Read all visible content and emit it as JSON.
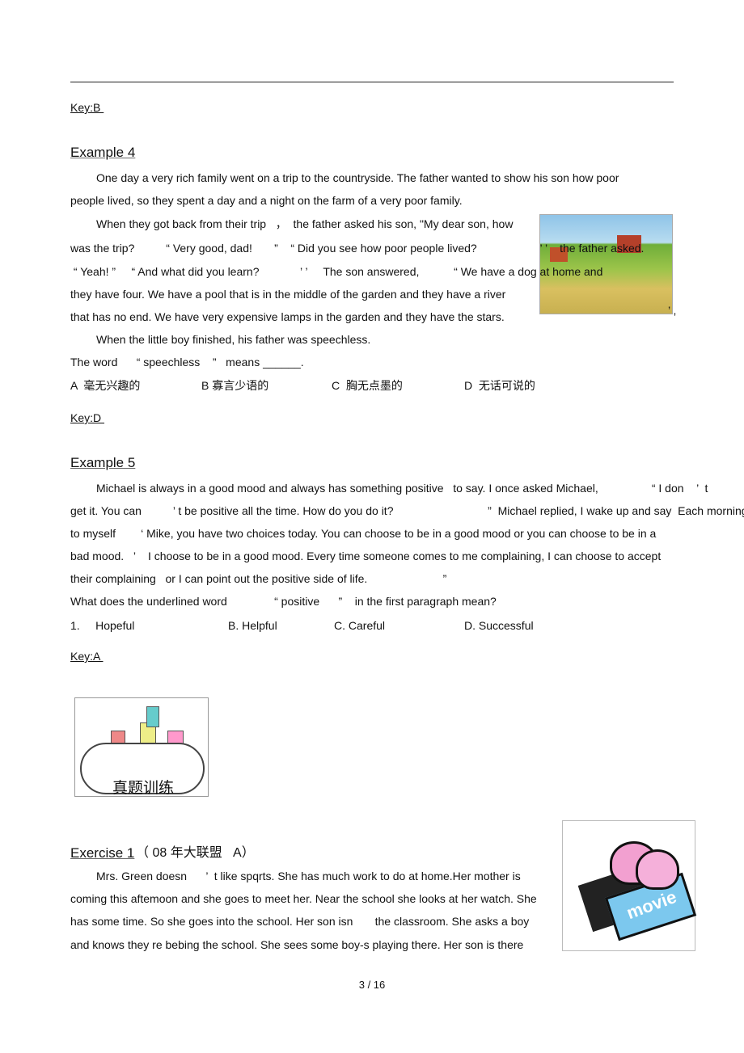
{
  "keys": {
    "k3": "Key:B ",
    "k4": "Key:D ",
    "k5": "Key:A "
  },
  "ex4": {
    "title": "Example 4",
    "lines": [
      "One day a very rich family went on a trip to the countryside. The father wanted to show his son how poor",
      "people lived, so they spent a day and a night on the farm of a very poor family.",
      "When they got back from their trip   ，  the father asked his son, \"My dear son, how",
      "was the trip?          “ Very good, dad!       ”    “ Did you see how poor people lived?                    ’ ’    the father asked.",
      " “ Yeah! ”     “ And what did you learn?             ’ ’     The son answered,           “ We have a dog at home and",
      "they have four. We have a pool that is in the middle of the garden and they have a river",
      "that has no end. We have very expensive lamps in the garden and they have the stars.",
      "When the little boy finished, his father was speechless.",
      "The word      “ speechless    ”   means ______."
    ],
    "trailing_quote": "’ ,",
    "options": [
      "A  毫无兴趣的",
      "B 寡言少语的",
      "C  胸无点墨的",
      "D  无话可说的"
    ]
  },
  "ex5": {
    "title": "Example 5",
    "lines": [
      "Michael is always in a good mood and always has something positive   to say. I once asked Michael,                 “ I don    ’  t",
      "get it. You can          ’ t be positive all the time. How do you do it?                              ”  Michael replied, I wake up and say  Each morning",
      "to myself        ‘ Mike, you have two choices today. You can choose to be in a good mood or you can choose to be in a",
      "bad mood.   ’    I choose to be in a good mood. Every time someone comes to me complaining, I can choose to accept",
      "their complaining   or I can point out the positive side of life.                        ”",
      "What does the underlined word               “ positive      ”    in the first paragraph mean?"
    ],
    "options": [
      "1.     Hopeful",
      "B. Helpful",
      "C. Careful",
      "D. Successful"
    ]
  },
  "banner": "真题训练",
  "exercise1": {
    "title": "Exercise 1",
    "subtitle": "（ 08 年大联盟   A）",
    "lines": [
      "Mrs. Green doesn      ’  t like spqrts. She has much work to do at home.Her mother is",
      "coming this aftemoon and she goes to meet her. Near the school she looks at her watch. She",
      "has some time. So she goes into the school. Her son isn       the classroom. She asks a boy",
      "and knows they re bebing the school. She sees some boy-s playing there. Her son is there"
    ]
  },
  "movie_logo": "movie",
  "footer": {
    "page": "3 /  16"
  }
}
